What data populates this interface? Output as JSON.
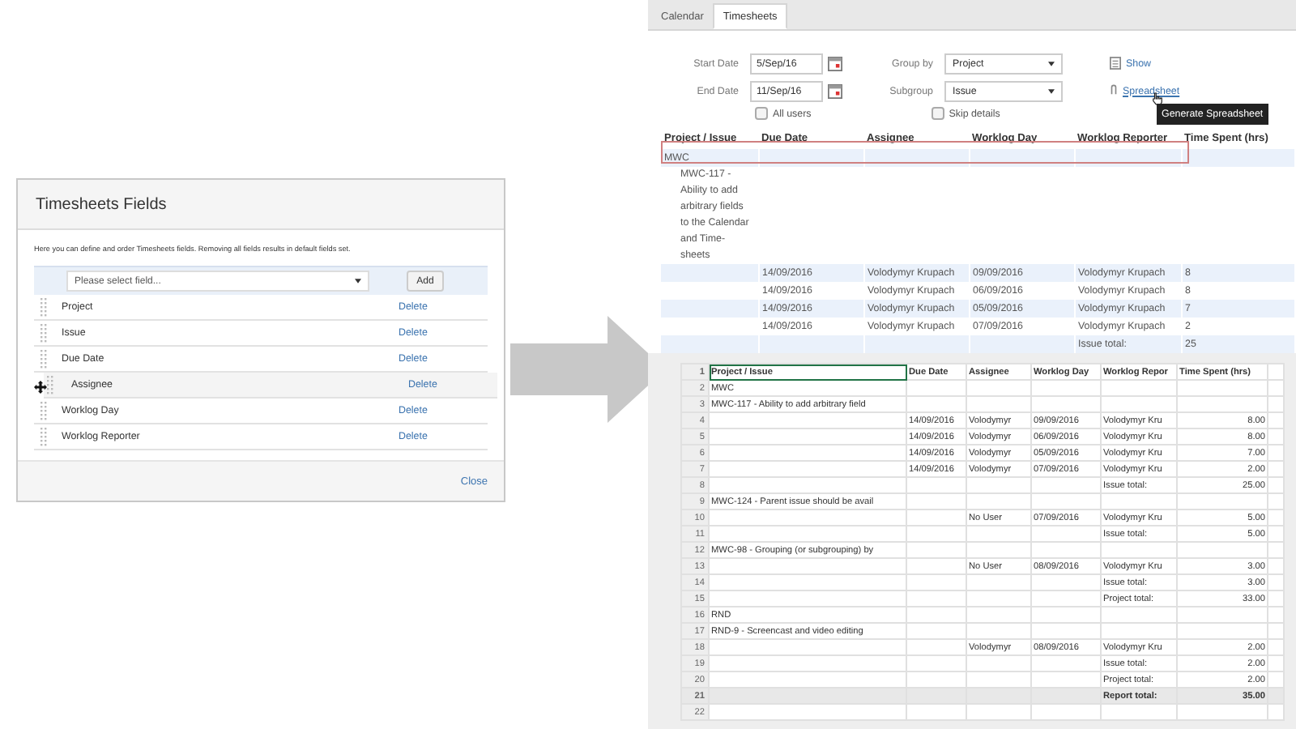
{
  "dialog": {
    "title": "Timesheets Fields",
    "description": "Here you can define and order Timesheets fields. Removing all fields results in default fields set.",
    "select": {
      "placeholder": "Please select field..."
    },
    "add_button": "Add",
    "fields": [
      {
        "name": "Project",
        "action": "Delete",
        "dragging": false
      },
      {
        "name": "Issue",
        "action": "Delete",
        "dragging": false
      },
      {
        "name": "Due Date",
        "action": "Delete",
        "dragging": false
      },
      {
        "name": "Assignee",
        "action": "Delete",
        "dragging": true
      },
      {
        "name": "Worklog Day",
        "action": "Delete",
        "dragging": false
      },
      {
        "name": "Worklog Reporter",
        "action": "Delete",
        "dragging": false
      }
    ],
    "close_button": "Close"
  },
  "report": {
    "tabs": [
      {
        "label": "Calendar",
        "selected": false
      },
      {
        "label": "Timesheets",
        "selected": true
      }
    ],
    "start_date": {
      "label": "Start Date",
      "value": "5/Sep/16"
    },
    "end_date": {
      "label": "End Date",
      "value": "11/Sep/16"
    },
    "group_by": {
      "label": "Group by",
      "value": "Project"
    },
    "subgroup": {
      "label": "Subgroup",
      "value": "Issue"
    },
    "all_users": {
      "label": "All users",
      "checked": false
    },
    "skip_details": {
      "label": "Skip details",
      "checked": false
    },
    "show_link": "Show",
    "spreadsheet_link": "Spreadsheet",
    "tooltip": "Generate Spreadsheet",
    "table": {
      "columns": [
        "Project / Issue",
        "Due Date",
        "Assignee",
        "Worklog Day",
        "Worklog Reporter",
        "Time Spent (hrs)"
      ],
      "rows": [
        {
          "kind": "group",
          "cells": [
            "MWC",
            null,
            null,
            null,
            null,
            null
          ]
        },
        {
          "kind": "issue",
          "cells": [
            "MWC-117 - Ability to add arbitrary fields to the Calendar and Time-sheets",
            null,
            null,
            null,
            null,
            null
          ]
        },
        {
          "kind": "entry",
          "cells": [
            null,
            "14/09/2016",
            "Volodymyr Krupach",
            "09/09/2016",
            "Volodymyr Krupach",
            "8"
          ]
        },
        {
          "kind": "entry",
          "cells": [
            null,
            "14/09/2016",
            "Volodymyr Krupach",
            "06/09/2016",
            "Volodymyr Krupach",
            "8"
          ]
        },
        {
          "kind": "entry",
          "cells": [
            null,
            "14/09/2016",
            "Volodymyr Krupach",
            "05/09/2016",
            "Volodymyr Krupach",
            "7"
          ]
        },
        {
          "kind": "entry",
          "cells": [
            null,
            "14/09/2016",
            "Volodymyr Krupach",
            "07/09/2016",
            "Volodymyr Krupach",
            "2"
          ]
        },
        {
          "kind": "total",
          "cells": [
            null,
            null,
            null,
            null,
            "Issue total:",
            "25"
          ]
        }
      ]
    }
  },
  "spreadsheet": {
    "rows": [
      {
        "num": "1",
        "kind": "header",
        "cells": [
          "Project / Issue",
          "Due Date",
          "Assignee",
          "Worklog Day",
          "Worklog Repor",
          "Time Spent (hrs)"
        ]
      },
      {
        "num": "2",
        "kind": "normal",
        "cells": [
          "MWC",
          null,
          null,
          null,
          null,
          null
        ]
      },
      {
        "num": "3",
        "kind": "normal",
        "cells": [
          "MWC-117 - Ability to add arbitrary field",
          null,
          null,
          null,
          null,
          null
        ]
      },
      {
        "num": "4",
        "kind": "normal",
        "cells": [
          null,
          "14/09/2016",
          "Volodymyr",
          "09/09/2016",
          "Volodymyr Kru",
          "8.00"
        ]
      },
      {
        "num": "5",
        "kind": "normal",
        "cells": [
          null,
          "14/09/2016",
          "Volodymyr",
          "06/09/2016",
          "Volodymyr Kru",
          "8.00"
        ]
      },
      {
        "num": "6",
        "kind": "normal",
        "cells": [
          null,
          "14/09/2016",
          "Volodymyr",
          "05/09/2016",
          "Volodymyr Kru",
          "7.00"
        ]
      },
      {
        "num": "7",
        "kind": "normal",
        "cells": [
          null,
          "14/09/2016",
          "Volodymyr",
          "07/09/2016",
          "Volodymyr Kru",
          "2.00"
        ]
      },
      {
        "num": "8",
        "kind": "normal",
        "cells": [
          null,
          null,
          null,
          null,
          "Issue total:",
          "25.00"
        ]
      },
      {
        "num": "9",
        "kind": "normal",
        "cells": [
          "MWC-124 - Parent issue should be avail",
          null,
          null,
          null,
          null,
          null
        ]
      },
      {
        "num": "10",
        "kind": "normal",
        "cells": [
          null,
          null,
          "No User",
          "07/09/2016",
          "Volodymyr Kru",
          "5.00"
        ]
      },
      {
        "num": "11",
        "kind": "normal",
        "cells": [
          null,
          null,
          null,
          null,
          "Issue total:",
          "5.00"
        ]
      },
      {
        "num": "12",
        "kind": "normal",
        "cells": [
          "MWC-98 - Grouping (or subgrouping) by",
          null,
          null,
          null,
          null,
          null
        ]
      },
      {
        "num": "13",
        "kind": "normal",
        "cells": [
          null,
          null,
          "No User",
          "08/09/2016",
          "Volodymyr Kru",
          "3.00"
        ]
      },
      {
        "num": "14",
        "kind": "normal",
        "cells": [
          null,
          null,
          null,
          null,
          "Issue total:",
          "3.00"
        ]
      },
      {
        "num": "15",
        "kind": "normal",
        "cells": [
          null,
          null,
          null,
          null,
          "Project total:",
          "33.00"
        ]
      },
      {
        "num": "16",
        "kind": "normal",
        "cells": [
          "RND",
          null,
          null,
          null,
          null,
          null
        ]
      },
      {
        "num": "17",
        "kind": "normal",
        "cells": [
          "RND-9 - Screencast and video editing",
          null,
          null,
          null,
          null,
          null
        ]
      },
      {
        "num": "18",
        "kind": "normal",
        "cells": [
          null,
          null,
          "Volodymyr",
          "08/09/2016",
          "Volodymyr Kru",
          "2.00"
        ]
      },
      {
        "num": "19",
        "kind": "normal",
        "cells": [
          null,
          null,
          null,
          null,
          "Issue total:",
          "2.00"
        ]
      },
      {
        "num": "20",
        "kind": "normal",
        "cells": [
          null,
          null,
          null,
          null,
          "Project total:",
          "2.00"
        ]
      },
      {
        "num": "21",
        "kind": "total",
        "cells": [
          null,
          null,
          null,
          null,
          "Report total:",
          "35.00"
        ]
      },
      {
        "num": "22",
        "kind": "normal",
        "cells": [
          null,
          null,
          null,
          null,
          null,
          null
        ]
      }
    ]
  }
}
